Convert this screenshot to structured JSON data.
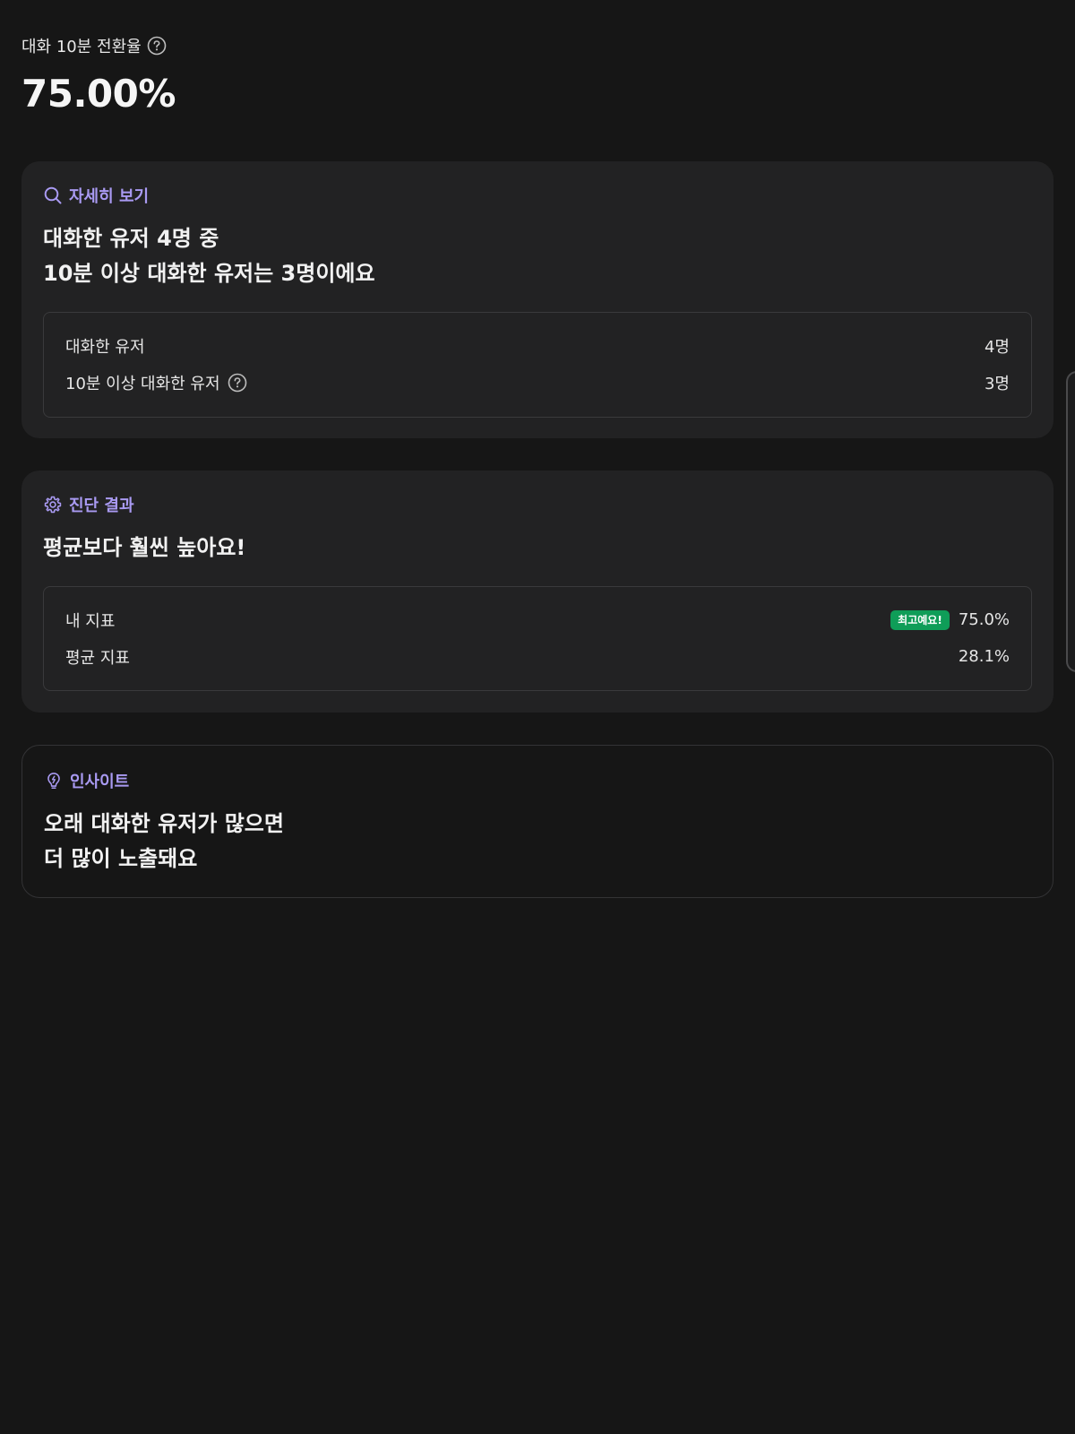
{
  "metric": {
    "label": "대화 10분 전환율",
    "value": "75.00%"
  },
  "detail_card": {
    "tag": "자세히 보기",
    "title_line1": "대화한 유저 4명 중",
    "title_line2": "10분 이상 대화한 유저는 3명이에요",
    "rows": [
      {
        "label": "대화한 유저",
        "value": "4명"
      },
      {
        "label": "10분 이상 대화한 유저",
        "value": "3명"
      }
    ]
  },
  "diagnosis_card": {
    "tag": "진단 결과",
    "title": "평균보다 훨씬 높아요!",
    "rows": [
      {
        "label": "내 지표",
        "badge": "최고예요!",
        "value": "75.0%"
      },
      {
        "label": "평균 지표",
        "value": "28.1%"
      }
    ]
  },
  "insight_card": {
    "tag": "인사이트",
    "title_line1": "오래 대화한 유저가 많으면",
    "title_line2": "더 많이 노출돼요"
  },
  "colors": {
    "background": "#161616",
    "card": "#222223",
    "accent": "#a99af2",
    "badge": "#0f9d58"
  },
  "icons": {
    "metric_help": "question-circle-icon",
    "detail_tag": "search-icon",
    "diagnosis_tag": "gear-icon",
    "insight_tag": "lightbulb-icon"
  }
}
